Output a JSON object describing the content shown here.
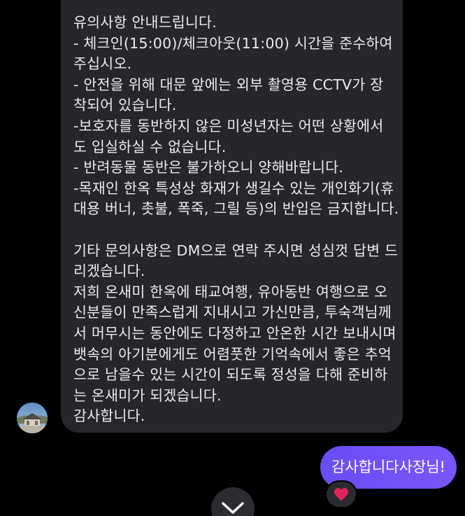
{
  "received_message": {
    "lines": [
      "유의사항 안내드립니다.",
      "- 체크인(15:00)/체크아웃(11:00) 시간을 준수하여",
      "주십시오.",
      "- 안전을 위해 대문 앞에는 외부 촬영용 CCTV가 장",
      "착되어 있습니다.",
      "-보호자를 동반하지 않은 미성년자는 어떤 상황에서",
      "도 입실하실 수 없습니다.",
      "- 반려동물 동반은 불가하오니 양해바랍니다.",
      "-목재인 한옥 특성상 화재가 생길수 있는 개인화기(휴",
      "대용 버너, 촛불, 폭죽, 그릴 등)의 반입은 금지합니다.",
      "",
      "기타 문의사항은 DM으로 연락 주시면 성심껏 답변 드",
      "리겠습니다.",
      "저희 온새미 한옥에 태교여행, 유아동반 여행으로 오",
      "신분들이 만족스럽게 지내시고 가신만큼, 투숙객님께",
      "서 머무시는 동안에도 다정하고 안온한 시간 보내시며",
      "뱃속의 아기분에게도 어렴풋한 기억속에서 좋은 추억",
      "으로 남을수 있는 시간이 되도록 정성을 다해 준비하",
      "는 온새미가 되겠습니다.",
      "감사합니다."
    ]
  },
  "sent_message": {
    "text": "감사합니다사장님!"
  },
  "reaction": {
    "icon": "heart-icon",
    "color": "#e0245e"
  },
  "colors": {
    "background": "#000000",
    "received_bubble": "#26272c",
    "sent_bubble": "#6f50f6"
  }
}
